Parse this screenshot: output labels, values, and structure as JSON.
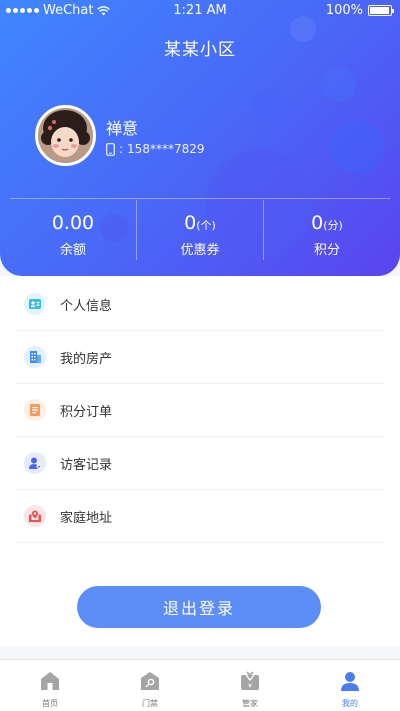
{
  "status_bar": {
    "carrier": "WeChat",
    "time": "1:21 AM",
    "battery": "100%"
  },
  "header": {
    "title": "某某小区",
    "user": {
      "name": "禅意",
      "phone": "158****7829"
    }
  },
  "stats": [
    {
      "value": "0.00",
      "unit": "",
      "label": "余额"
    },
    {
      "value": "0",
      "unit": "(个)",
      "label": "优惠券"
    },
    {
      "value": "0",
      "unit": "(分)",
      "label": "积分"
    }
  ],
  "menu": [
    {
      "label": "个人信息",
      "icon": "id-card-icon",
      "color": "#3bb8e6"
    },
    {
      "label": "我的房产",
      "icon": "building-icon",
      "color": "#3c8ff0"
    },
    {
      "label": "积分订单",
      "icon": "order-list-icon",
      "color": "#f29b5b"
    },
    {
      "label": "访客记录",
      "icon": "visitor-icon",
      "color": "#4a66e8"
    },
    {
      "label": "家庭地址",
      "icon": "address-icon",
      "color": "#e8524f"
    }
  ],
  "logout_label": "退出登录",
  "tabs": [
    {
      "label": "首页",
      "icon": "home-icon"
    },
    {
      "label": "门禁",
      "icon": "access-icon"
    },
    {
      "label": "管家",
      "icon": "butler-icon"
    },
    {
      "label": "我的",
      "icon": "profile-icon"
    }
  ],
  "colors": {
    "accent": "#4a66f7",
    "button": "#5d8df7",
    "active_tab": "#4a7df3",
    "inactive_tab": "#aaaaaa"
  }
}
